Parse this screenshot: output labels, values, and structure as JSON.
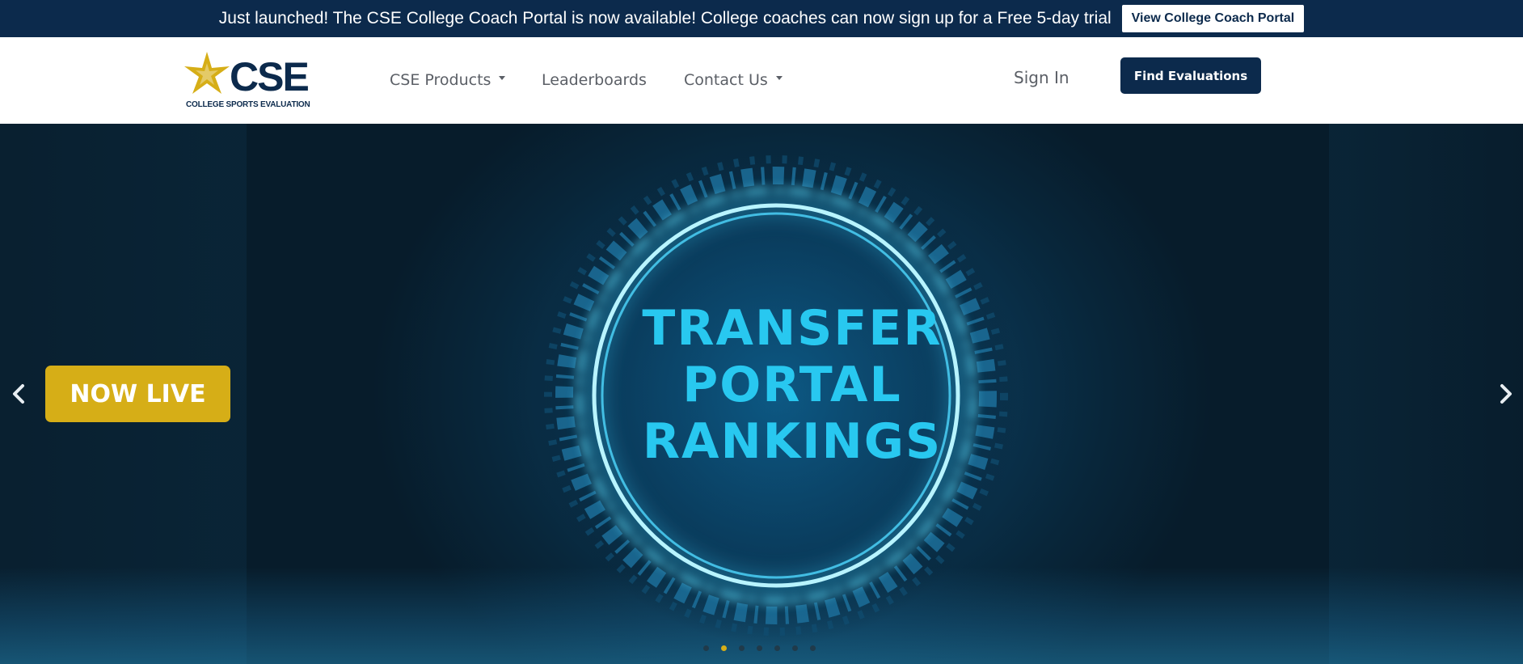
{
  "announcement": {
    "text": "Just launched! The CSE College Coach Portal is now available! College coaches can now sign up for a Free 5-day trial",
    "button_label": "View College Coach Portal"
  },
  "logo": {
    "wordmark": "CSE",
    "subtitle": "COLLEGE SPORTS EVALUATION"
  },
  "nav": {
    "items": [
      {
        "label": "CSE Products",
        "has_dropdown": true
      },
      {
        "label": "Leaderboards",
        "has_dropdown": false
      },
      {
        "label": "Contact Us",
        "has_dropdown": true
      }
    ],
    "sign_in": "Sign In",
    "cta": "Find Evaluations"
  },
  "hero": {
    "badge": "NOW LIVE",
    "title_lines": [
      "TRANSFER",
      "PORTAL",
      "RANKINGS"
    ],
    "prev_icon": "chevron-left-icon",
    "next_icon": "chevron-right-icon",
    "slide_count": 7,
    "active_slide": 2
  },
  "colors": {
    "navy": "#0c2a4c",
    "gold": "#d6ae17",
    "cyan": "#28c8f0"
  }
}
